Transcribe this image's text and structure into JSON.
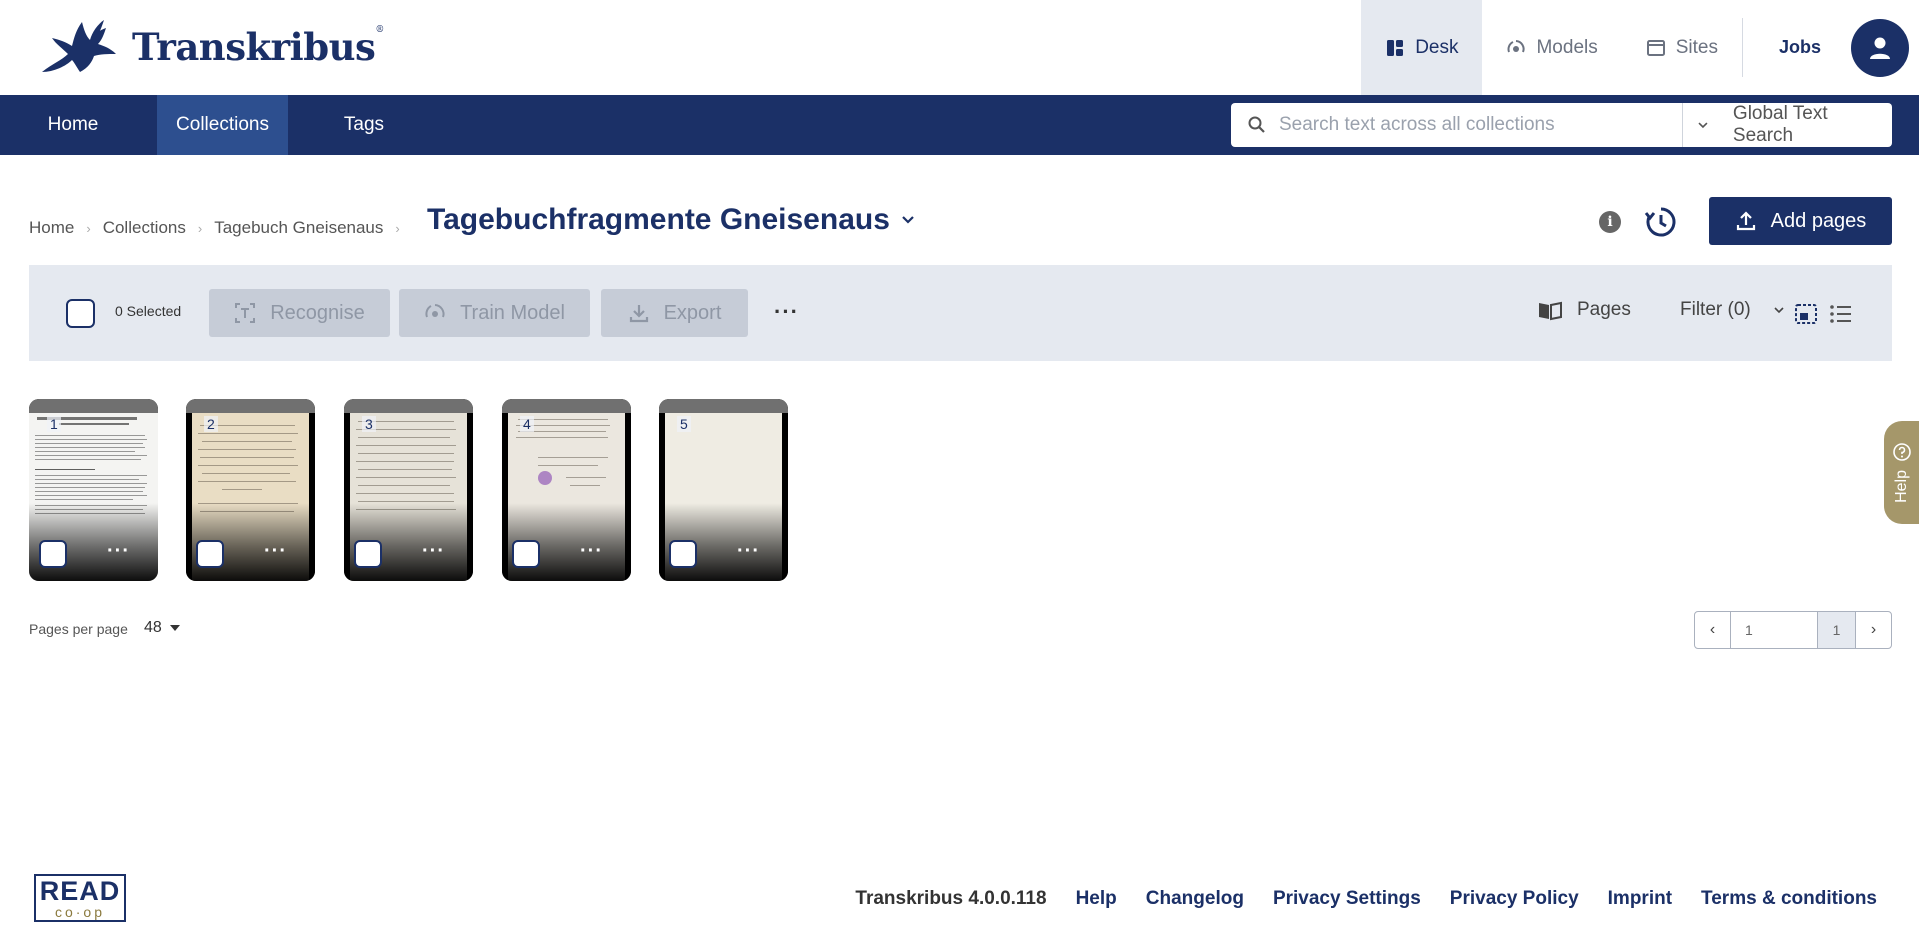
{
  "app": {
    "brand": "Transkribus",
    "brand_mark": "®"
  },
  "topnav": {
    "items": [
      {
        "label": "Desk",
        "icon": "desk-icon",
        "active": true
      },
      {
        "label": "Models",
        "icon": "models-icon",
        "active": false
      },
      {
        "label": "Sites",
        "icon": "sites-icon",
        "active": false
      }
    ],
    "jobs_label": "Jobs",
    "avatar_icon": "user-icon"
  },
  "navbar": {
    "items": [
      {
        "label": "Home",
        "active": false
      },
      {
        "label": "Collections",
        "active": true
      },
      {
        "label": "Tags",
        "active": false
      }
    ],
    "search": {
      "placeholder": "Search text across all collections",
      "value": "",
      "scope": "Global Text Search"
    }
  },
  "breadcrumb": [
    "Home",
    "Collections",
    "Tagebuch Gneisenaus"
  ],
  "page_title": "Tagebuchfragmente Gneisenaus",
  "actions": {
    "add_pages_label": "Add pages"
  },
  "toolbar": {
    "selected_label": "0 Selected",
    "recognise_label": "Recognise",
    "train_label": "Train Model",
    "export_label": "Export",
    "more_label": "···",
    "pages_label": "Pages",
    "filter_label": "Filter (0)"
  },
  "thumbnails": [
    {
      "number": "1",
      "more": "···"
    },
    {
      "number": "2",
      "more": "···"
    },
    {
      "number": "3",
      "more": "···"
    },
    {
      "number": "4",
      "more": "···"
    },
    {
      "number": "5",
      "more": "···"
    }
  ],
  "pagination": {
    "per_page_label": "Pages per page",
    "per_page_value": "48",
    "current_page": "1",
    "total_pages": "1"
  },
  "help_label": "Help",
  "footer": {
    "logo_top": "READ",
    "logo_bottom": "co·op",
    "version": "Transkribus 4.0.0.118",
    "links": [
      "Help",
      "Changelog",
      "Privacy Settings",
      "Privacy Policy",
      "Imprint",
      "Terms & conditions"
    ]
  },
  "colors": {
    "primary": "#1b3067",
    "nav_active": "#2d4f8f",
    "toolbar_bg": "#e5e9f0",
    "help_tab": "#a5976a"
  }
}
